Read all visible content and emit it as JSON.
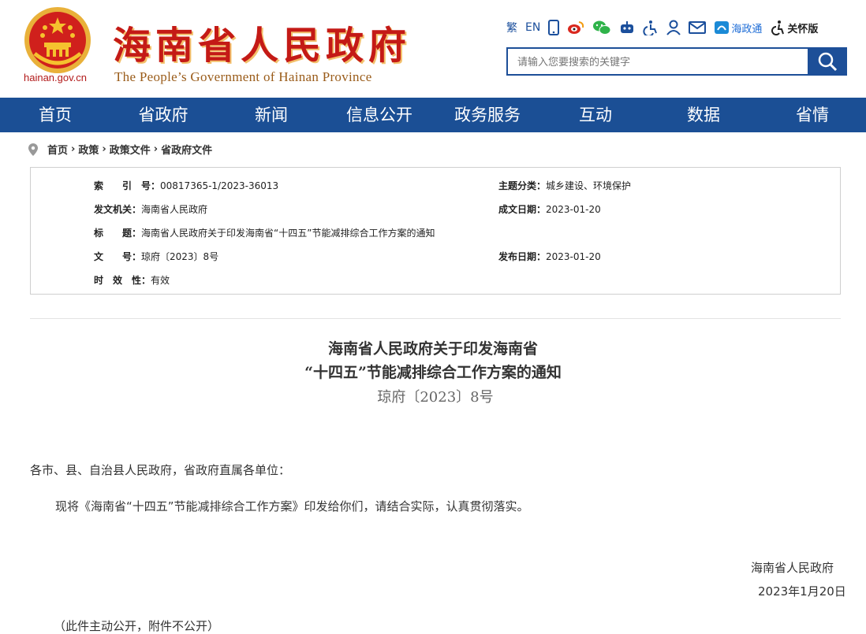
{
  "header": {
    "domain": "hainan.gov.cn",
    "title": "海南省人民政府",
    "subtitle": "The People’s Government  of Hainan Province",
    "topbar": {
      "traditional": "繁",
      "english": "EN",
      "hzt": "海政通",
      "care_mode": "关怀版"
    },
    "search_placeholder": "请输入您要搜索的关键字"
  },
  "nav": [
    "首页",
    "省政府",
    "新闻",
    "信息公开",
    "政务服务",
    "互动",
    "数据",
    "省情"
  ],
  "breadcrumb": [
    "首页",
    "政策",
    "政策文件",
    "省政府文件"
  ],
  "info": {
    "index_label": "索　　引　号：",
    "index_value": "00817365-1/2023-36013",
    "topic_label": "主题分类：",
    "topic_value": "城乡建设、环境保护",
    "issuer_label": "发文机关：",
    "issuer_value": "海南省人民政府",
    "written_label": "成文日期：",
    "written_value": "2023-01-20",
    "title_label": "标　　题：",
    "title_value": "海南省人民政府关于印发海南省“十四五”节能减排综合工作方案的通知",
    "docno_label": "文　　号：",
    "docno_value": "琼府〔2023〕8号",
    "publish_label": "发布日期：",
    "publish_value": "2023-01-20",
    "validity_label": "时　效　性：",
    "validity_value": "有效"
  },
  "doc": {
    "title_line1": "海南省人民政府关于印发海南省",
    "title_line2": "“十四五”节能减排综合工作方案的通知",
    "doc_no": "琼府〔2023〕8号",
    "salutation": "各市、县、自治县人民政府，省政府直属各单位：",
    "body": "现将《海南省“十四五”节能减排综合工作方案》印发给你们，请结合实际，认真贯彻落实。",
    "signature": "海南省人民政府",
    "date": "2023年1月20日",
    "note": "（此件主动公开，附件不公开）"
  }
}
